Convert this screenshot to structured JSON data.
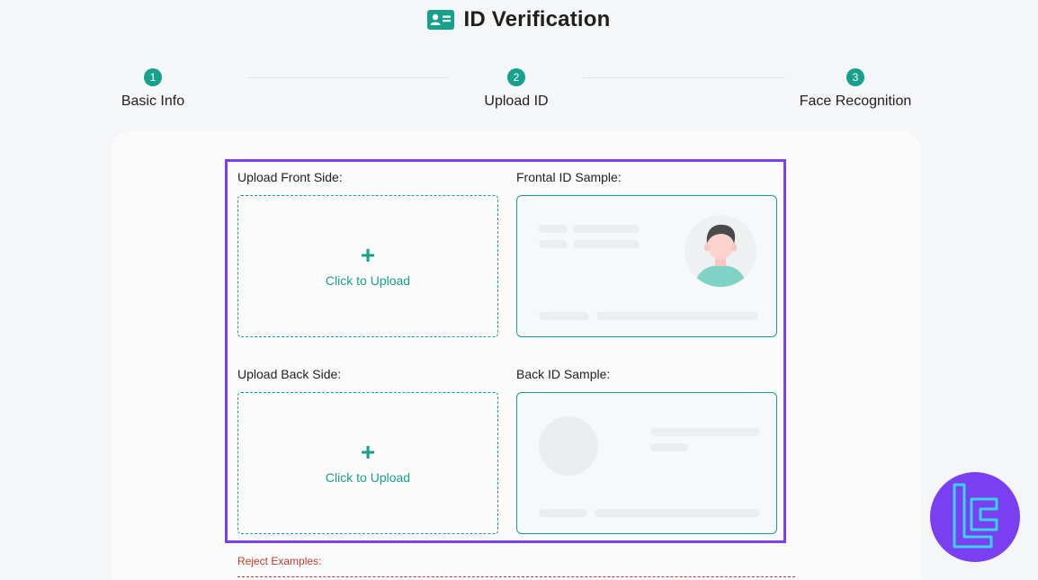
{
  "header": {
    "icon": "id-card-icon",
    "title": "ID Verification"
  },
  "steps": [
    {
      "number": "1",
      "label": "Basic Info"
    },
    {
      "number": "2",
      "label": "Upload ID"
    },
    {
      "number": "3",
      "label": "Face Recognition"
    }
  ],
  "upload": {
    "front_label": "Upload Front Side:",
    "back_label": "Upload Back Side:",
    "button_text": "Click to Upload",
    "plus": "+"
  },
  "samples": {
    "front_label": "Frontal ID Sample:",
    "back_label": "Back ID Sample:"
  },
  "reject": {
    "label": "Reject Examples:"
  },
  "colors": {
    "accent": "#17a08b",
    "highlight": "#7a3ff0",
    "reject": "#c0392b",
    "logo": "#7b3ff2"
  }
}
